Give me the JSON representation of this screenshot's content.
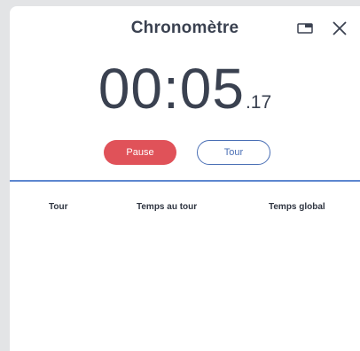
{
  "window": {
    "title": "Chronomètre"
  },
  "timer": {
    "main": "00:05",
    "centiseconds": ".17"
  },
  "controls": {
    "pause_label": "Pause",
    "lap_label": "Tour"
  },
  "table": {
    "headers": [
      "Tour",
      "Temps au tour",
      "Temps global"
    ]
  },
  "colors": {
    "pause": "#e05259",
    "accent": "#4a6fb5",
    "text": "#3a4150"
  },
  "icons": {
    "miniplayer": "picture-in-picture-icon",
    "close": "close-icon"
  }
}
